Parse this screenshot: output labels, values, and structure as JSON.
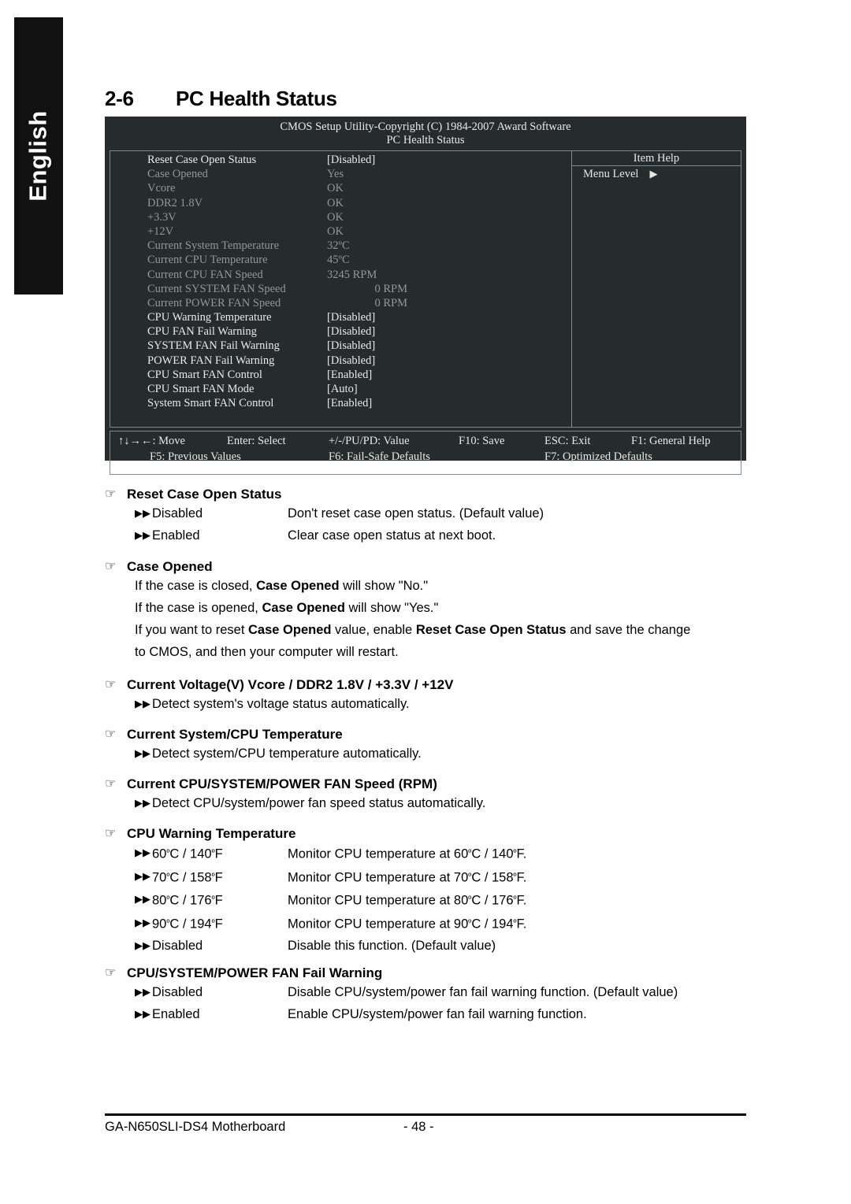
{
  "language_tab": {
    "label": "English"
  },
  "page_heading": {
    "number": "2-6",
    "title": "PC Health Status"
  },
  "bios": {
    "title": "CMOS Setup Utility-Copyright (C) 1984-2007 Award Software",
    "subtitle": "PC Health Status",
    "item_help": {
      "title": "Item Help",
      "menu_level_label": "Menu Level",
      "menu_level_arrow": "▶"
    },
    "rows": [
      {
        "label": "Reset Case Open Status",
        "value": "[Disabled]",
        "state": "bright",
        "align": "left"
      },
      {
        "label": "Case Opened",
        "value": "Yes",
        "state": "dim",
        "align": "left"
      },
      {
        "label": "Vcore",
        "value": "OK",
        "state": "dim",
        "align": "left"
      },
      {
        "label": "DDR2 1.8V",
        "value": "OK",
        "state": "dim",
        "align": "left"
      },
      {
        "label": "+3.3V",
        "value": "OK",
        "state": "dim",
        "align": "left"
      },
      {
        "label": "+12V",
        "value": "OK",
        "state": "dim",
        "align": "left"
      },
      {
        "label": "Current System Temperature",
        "value": "32ºC",
        "state": "dim",
        "align": "left"
      },
      {
        "label": "Current CPU Temperature",
        "value": "45ºC",
        "state": "dim",
        "align": "left"
      },
      {
        "label": "Current CPU FAN Speed",
        "value": "3245 RPM",
        "state": "dim",
        "align": "left"
      },
      {
        "label": "Current SYSTEM FAN Speed",
        "value": "0 RPM",
        "state": "dim",
        "align": "right"
      },
      {
        "label": "Current POWER FAN Speed",
        "value": "0 RPM",
        "state": "dim",
        "align": "right"
      },
      {
        "label": "CPU Warning Temperature",
        "value": "[Disabled]",
        "state": "bright",
        "align": "left"
      },
      {
        "label": "CPU FAN Fail Warning",
        "value": "[Disabled]",
        "state": "bright",
        "align": "left"
      },
      {
        "label": "SYSTEM FAN Fail Warning",
        "value": "[Disabled]",
        "state": "bright",
        "align": "left"
      },
      {
        "label": "POWER FAN Fail Warning",
        "value": "[Disabled]",
        "state": "bright",
        "align": "left"
      },
      {
        "label": "CPU Smart FAN Control",
        "value": "[Enabled]",
        "state": "bright",
        "align": "left"
      },
      {
        "label": "CPU Smart FAN Mode",
        "value": "[Auto]",
        "state": "bright",
        "align": "left"
      },
      {
        "label": "System Smart FAN Control",
        "value": "[Enabled]",
        "state": "bright",
        "align": "left"
      }
    ],
    "footer_keys": {
      "move": "↑↓→←: Move",
      "enter": "Enter: Select",
      "value": "+/-/PU/PD: Value",
      "f10": "F10: Save",
      "esc": "ESC: Exit",
      "f1": "F1: General Help",
      "f5": "F5: Previous Values",
      "f6": "F6: Fail-Safe Defaults",
      "f7": "F7: Optimized Defaults"
    }
  },
  "sections": {
    "reset_case_open_status": {
      "heading": "Reset Case Open Status",
      "options": [
        {
          "label": "Disabled",
          "desc": "Don't reset case open status. (Default value)"
        },
        {
          "label": "Enabled",
          "desc": "Clear case open status at next boot."
        }
      ]
    },
    "case_opened": {
      "heading": "Case Opened",
      "line1_a": "If the case is closed, ",
      "line1_b": "Case Opened",
      "line1_c": " will show \"No.\"",
      "line2_a": "If the case is opened, ",
      "line2_b": "Case Opened",
      "line2_c": " will show \"Yes.\"",
      "line3_a": "If you want to reset ",
      "line3_b": "Case Opened",
      "line3_c": " value, enable ",
      "line3_d": "Reset Case Open Status",
      "line3_e": " and save the change",
      "line4": "to CMOS, and then your computer will restart."
    },
    "current_voltage": {
      "heading": "Current Voltage(V) Vcore / DDR2 1.8V / +3.3V / +12V",
      "desc": "Detect system's voltage status automatically."
    },
    "current_temperature": {
      "heading": "Current System/CPU Temperature",
      "desc": "Detect system/CPU temperature automatically."
    },
    "current_fan_speed": {
      "heading": "Current CPU/SYSTEM/POWER FAN Speed (RPM)",
      "desc": "Detect CPU/system/power fan speed status automatically."
    },
    "cpu_warning_temperature": {
      "heading": "CPU Warning Temperature",
      "options": [
        {
          "label_c": "60",
          "label_f": "140",
          "desc_c": "60",
          "desc_f": "140"
        },
        {
          "label_c": "70",
          "label_f": "158",
          "desc_c": "70",
          "desc_f": "158"
        },
        {
          "label_c": "80",
          "label_f": "176",
          "desc_c": "80",
          "desc_f": "176"
        },
        {
          "label_c": "90",
          "label_f": "194",
          "desc_c": "90",
          "desc_f": "194"
        }
      ],
      "disabled_label": "Disabled",
      "disabled_desc": "Disable this function. (Default value)"
    },
    "fan_fail_warning": {
      "heading": "CPU/SYSTEM/POWER FAN Fail Warning",
      "options": [
        {
          "label": "Disabled",
          "desc": "Disable CPU/system/power fan fail warning function. (Default value)"
        },
        {
          "label": "Enabled",
          "desc": "Enable CPU/system/power fan fail warning function."
        }
      ]
    }
  },
  "page_footer": {
    "product": "GA-N650SLI-DS4 Motherboard",
    "page_number": "- 48 -"
  },
  "markers": {
    "hand": "☞",
    "bullet": "▶▶"
  }
}
